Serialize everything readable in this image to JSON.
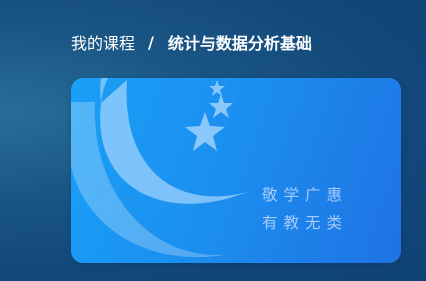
{
  "breadcrumb": {
    "parent_label": "我的课程",
    "separator": "/",
    "current_label": "统计与数据分析基础"
  },
  "course_card": {
    "logo_icon": "university-emblem-icon",
    "motto_line_1": "敬学广惠",
    "motto_line_2": "有教无类"
  },
  "colors": {
    "background": "#155083",
    "card_gradient_start": "#1aa0f6",
    "card_gradient_end": "#1f72e3",
    "text": "#ffffff"
  }
}
